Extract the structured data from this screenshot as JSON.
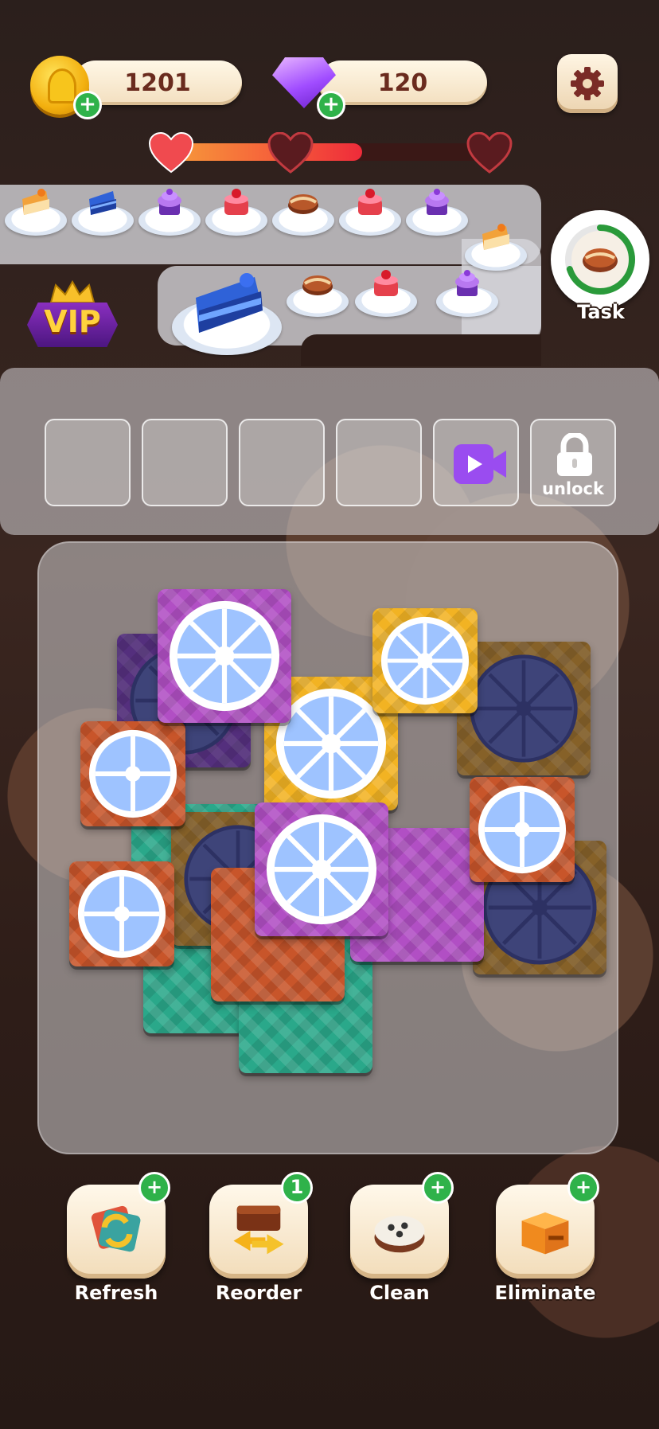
{
  "hud": {
    "coins": "1201",
    "gems": "120",
    "coin_icon": "cupcake-coin-icon",
    "gem_icon": "purple-gem-icon",
    "add_label": "+",
    "settings_icon": "gear-icon"
  },
  "progress": {
    "level": 0.6,
    "hearts": 3,
    "hearts_earned": 1
  },
  "tray": {
    "task_label": "Task",
    "task_progress": 0.7,
    "vip_label": "VIP",
    "orders_row1": [
      "orange-slice-cake",
      "blue-slice-cake",
      "purple-cupcake",
      "cherry-pudding",
      "chocolate-roll",
      "cherry-pudding",
      "purple-cupcake"
    ],
    "orders_row2": [
      "orange-slice-cake",
      "chocolate-roll",
      "cherry-pudding",
      "purple-cupcake"
    ],
    "current_order": "blue-slice-cake"
  },
  "slots": {
    "empty_count": 4,
    "video_icon": "video-camera-icon",
    "lock_icon": "padlock-icon",
    "unlock_label": "unlock"
  },
  "tools": [
    {
      "label": "Refresh",
      "badge": "+",
      "icon": "refresh-icon"
    },
    {
      "label": "Reorder",
      "badge": "1",
      "icon": "reorder-icon"
    },
    {
      "label": "Clean",
      "badge": "+",
      "icon": "cake-clean-icon"
    },
    {
      "label": "Eliminate",
      "badge": "+",
      "icon": "box-eliminate-icon"
    }
  ],
  "colors": {
    "purple": "#b14fc4",
    "yellow": "#f2b323",
    "orange": "#c8552a",
    "teal": "#2aa88a",
    "dark_purple": "#6c3aa0",
    "mustard": "#b8861e"
  }
}
